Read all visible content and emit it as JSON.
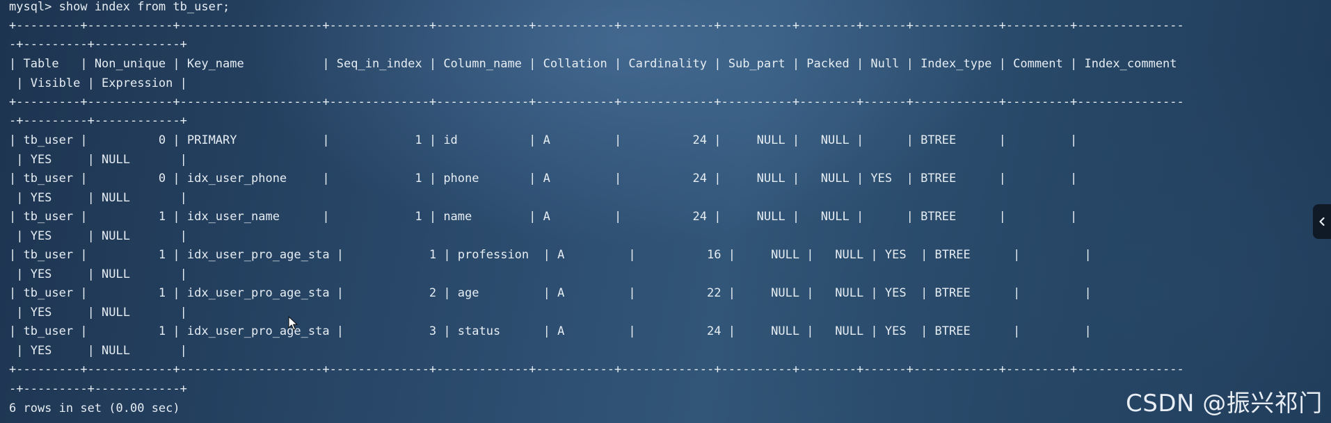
{
  "terminal": {
    "lines": [
      "mysql> show index from tb_user;",
      "+---------+------------+--------------------+--------------+-------------+-----------+-------------+----------+--------+------+------------+---------+---------------",
      "-+---------+------------+",
      "| Table   | Non_unique | Key_name           | Seq_in_index | Column_name | Collation | Cardinality | Sub_part | Packed | Null | Index_type | Comment | Index_comment",
      " | Visible | Expression |",
      "+---------+------------+--------------------+--------------+-------------+-----------+-------------+----------+--------+------+------------+---------+---------------",
      "-+---------+------------+",
      "| tb_user |          0 | PRIMARY            |            1 | id          | A         |          24 |     NULL |   NULL |      | BTREE      |         |",
      " | YES     | NULL       |",
      "| tb_user |          0 | idx_user_phone     |            1 | phone       | A         |          24 |     NULL |   NULL | YES  | BTREE      |         |",
      " | YES     | NULL       |",
      "| tb_user |          1 | idx_user_name      |            1 | name        | A         |          24 |     NULL |   NULL |      | BTREE      |         |",
      " | YES     | NULL       |",
      "| tb_user |          1 | idx_user_pro_age_sta |            1 | profession  | A         |          16 |     NULL |   NULL | YES  | BTREE      |         |",
      " | YES     | NULL       |",
      "| tb_user |          1 | idx_user_pro_age_sta |            2 | age         | A         |          22 |     NULL |   NULL | YES  | BTREE      |         |",
      " | YES     | NULL       |",
      "| tb_user |          1 | idx_user_pro_age_sta |            3 | status      | A         |          24 |     NULL |   NULL | YES  | BTREE      |         |",
      " | YES     | NULL       |",
      "+---------+------------+--------------------+--------------+-------------+-----------+-------------+----------+--------+------+------------+---------+---------------",
      "-+---------+------------+",
      "6 rows in set (0.00 sec)"
    ]
  },
  "watermark": "CSDN @振兴祁门",
  "side_handle": {
    "icon": "chevron-left-icon"
  }
}
